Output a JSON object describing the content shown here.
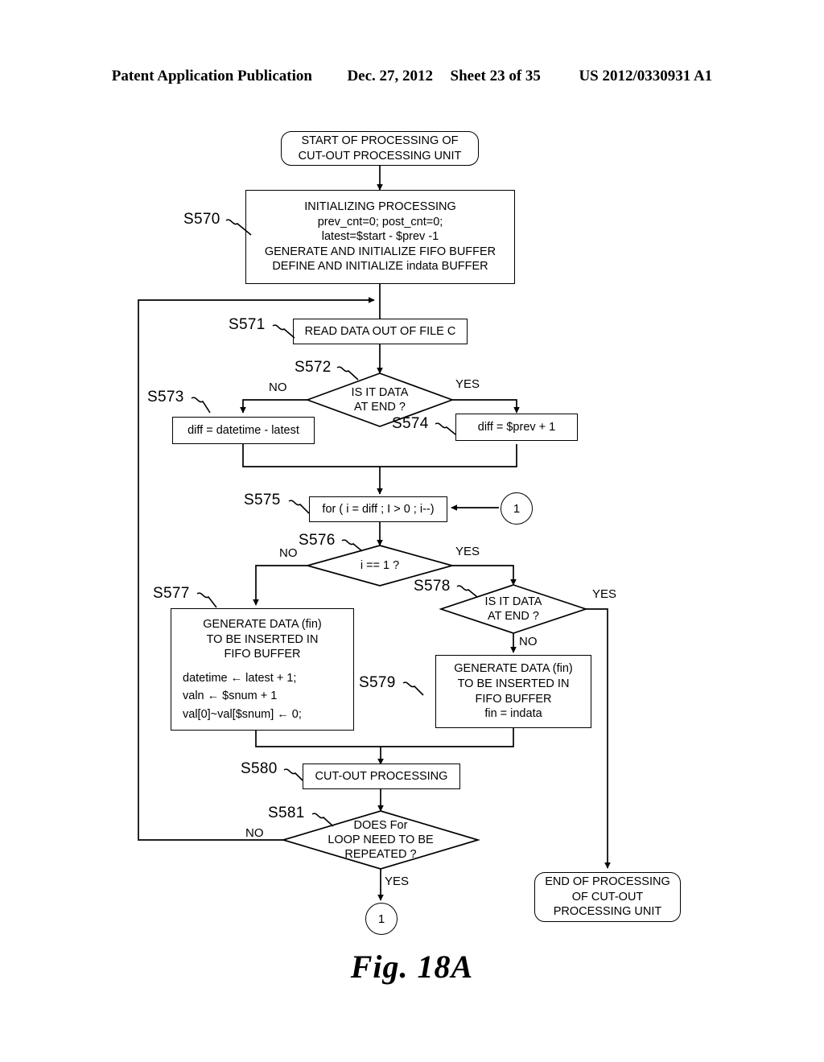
{
  "header": {
    "publication": "Patent Application Publication",
    "date": "Dec. 27, 2012",
    "sheet": "Sheet 23 of 35",
    "doc_number": "US 2012/0330931 A1"
  },
  "figure": {
    "caption": "Fig. 18A"
  },
  "nodes": {
    "start": {
      "lines": [
        "START OF PROCESSING OF",
        "CUT-OUT PROCESSING UNIT"
      ]
    },
    "s570": {
      "step": "S570",
      "lines": [
        "INITIALIZING PROCESSING",
        "prev_cnt=0; post_cnt=0;",
        "latest=$start - $prev -1",
        "GENERATE AND INITIALIZE FIFO BUFFER",
        "DEFINE AND INITIALIZE indata BUFFER"
      ]
    },
    "s571": {
      "step": "S571",
      "lines": [
        "READ DATA OUT OF FILE C"
      ]
    },
    "s572": {
      "step": "S572",
      "lines": [
        "IS IT DATA",
        "AT END ?"
      ],
      "no_label": "NO",
      "yes_label": "YES"
    },
    "s573": {
      "step": "S573",
      "lines": [
        "diff = datetime - latest"
      ]
    },
    "s574": {
      "step": "S574",
      "lines": [
        "diff = $prev + 1"
      ]
    },
    "s575": {
      "step": "S575",
      "lines": [
        "for ( i = diff ; I > 0 ; i--)"
      ]
    },
    "s576": {
      "step": "S576",
      "lines": [
        "i == 1 ?"
      ],
      "no_label": "NO",
      "yes_label": "YES"
    },
    "s577": {
      "step": "S577",
      "lines": [
        "GENERATE DATA (fin)",
        "TO BE INSERTED IN",
        "FIFO BUFFER"
      ],
      "code_lines": [
        "datetime ← latest + 1;",
        "valn ← $snum + 1",
        "val[0]~val[$snum] ← 0;"
      ]
    },
    "s578": {
      "step": "S578",
      "lines": [
        "IS IT DATA",
        "AT END ?"
      ],
      "no_label": "NO",
      "yes_label": "YES"
    },
    "s579": {
      "step": "S579",
      "lines": [
        "GENERATE DATA (fin)",
        "TO BE INSERTED IN",
        "FIFO BUFFER",
        "fin = indata"
      ]
    },
    "s580": {
      "step": "S580",
      "lines": [
        "CUT-OUT PROCESSING"
      ]
    },
    "s581": {
      "step": "S581",
      "lines": [
        "DOES For",
        "LOOP NEED TO BE",
        "REPEATED ?"
      ],
      "no_label": "NO",
      "yes_label": "YES"
    },
    "end": {
      "lines": [
        "END OF PROCESSING",
        "OF CUT-OUT",
        "PROCESSING UNIT"
      ]
    },
    "connector_right": {
      "label": "1"
    },
    "connector_bottom": {
      "label": "1"
    }
  },
  "colors": {
    "ink": "#000000",
    "paper": "#ffffff"
  }
}
